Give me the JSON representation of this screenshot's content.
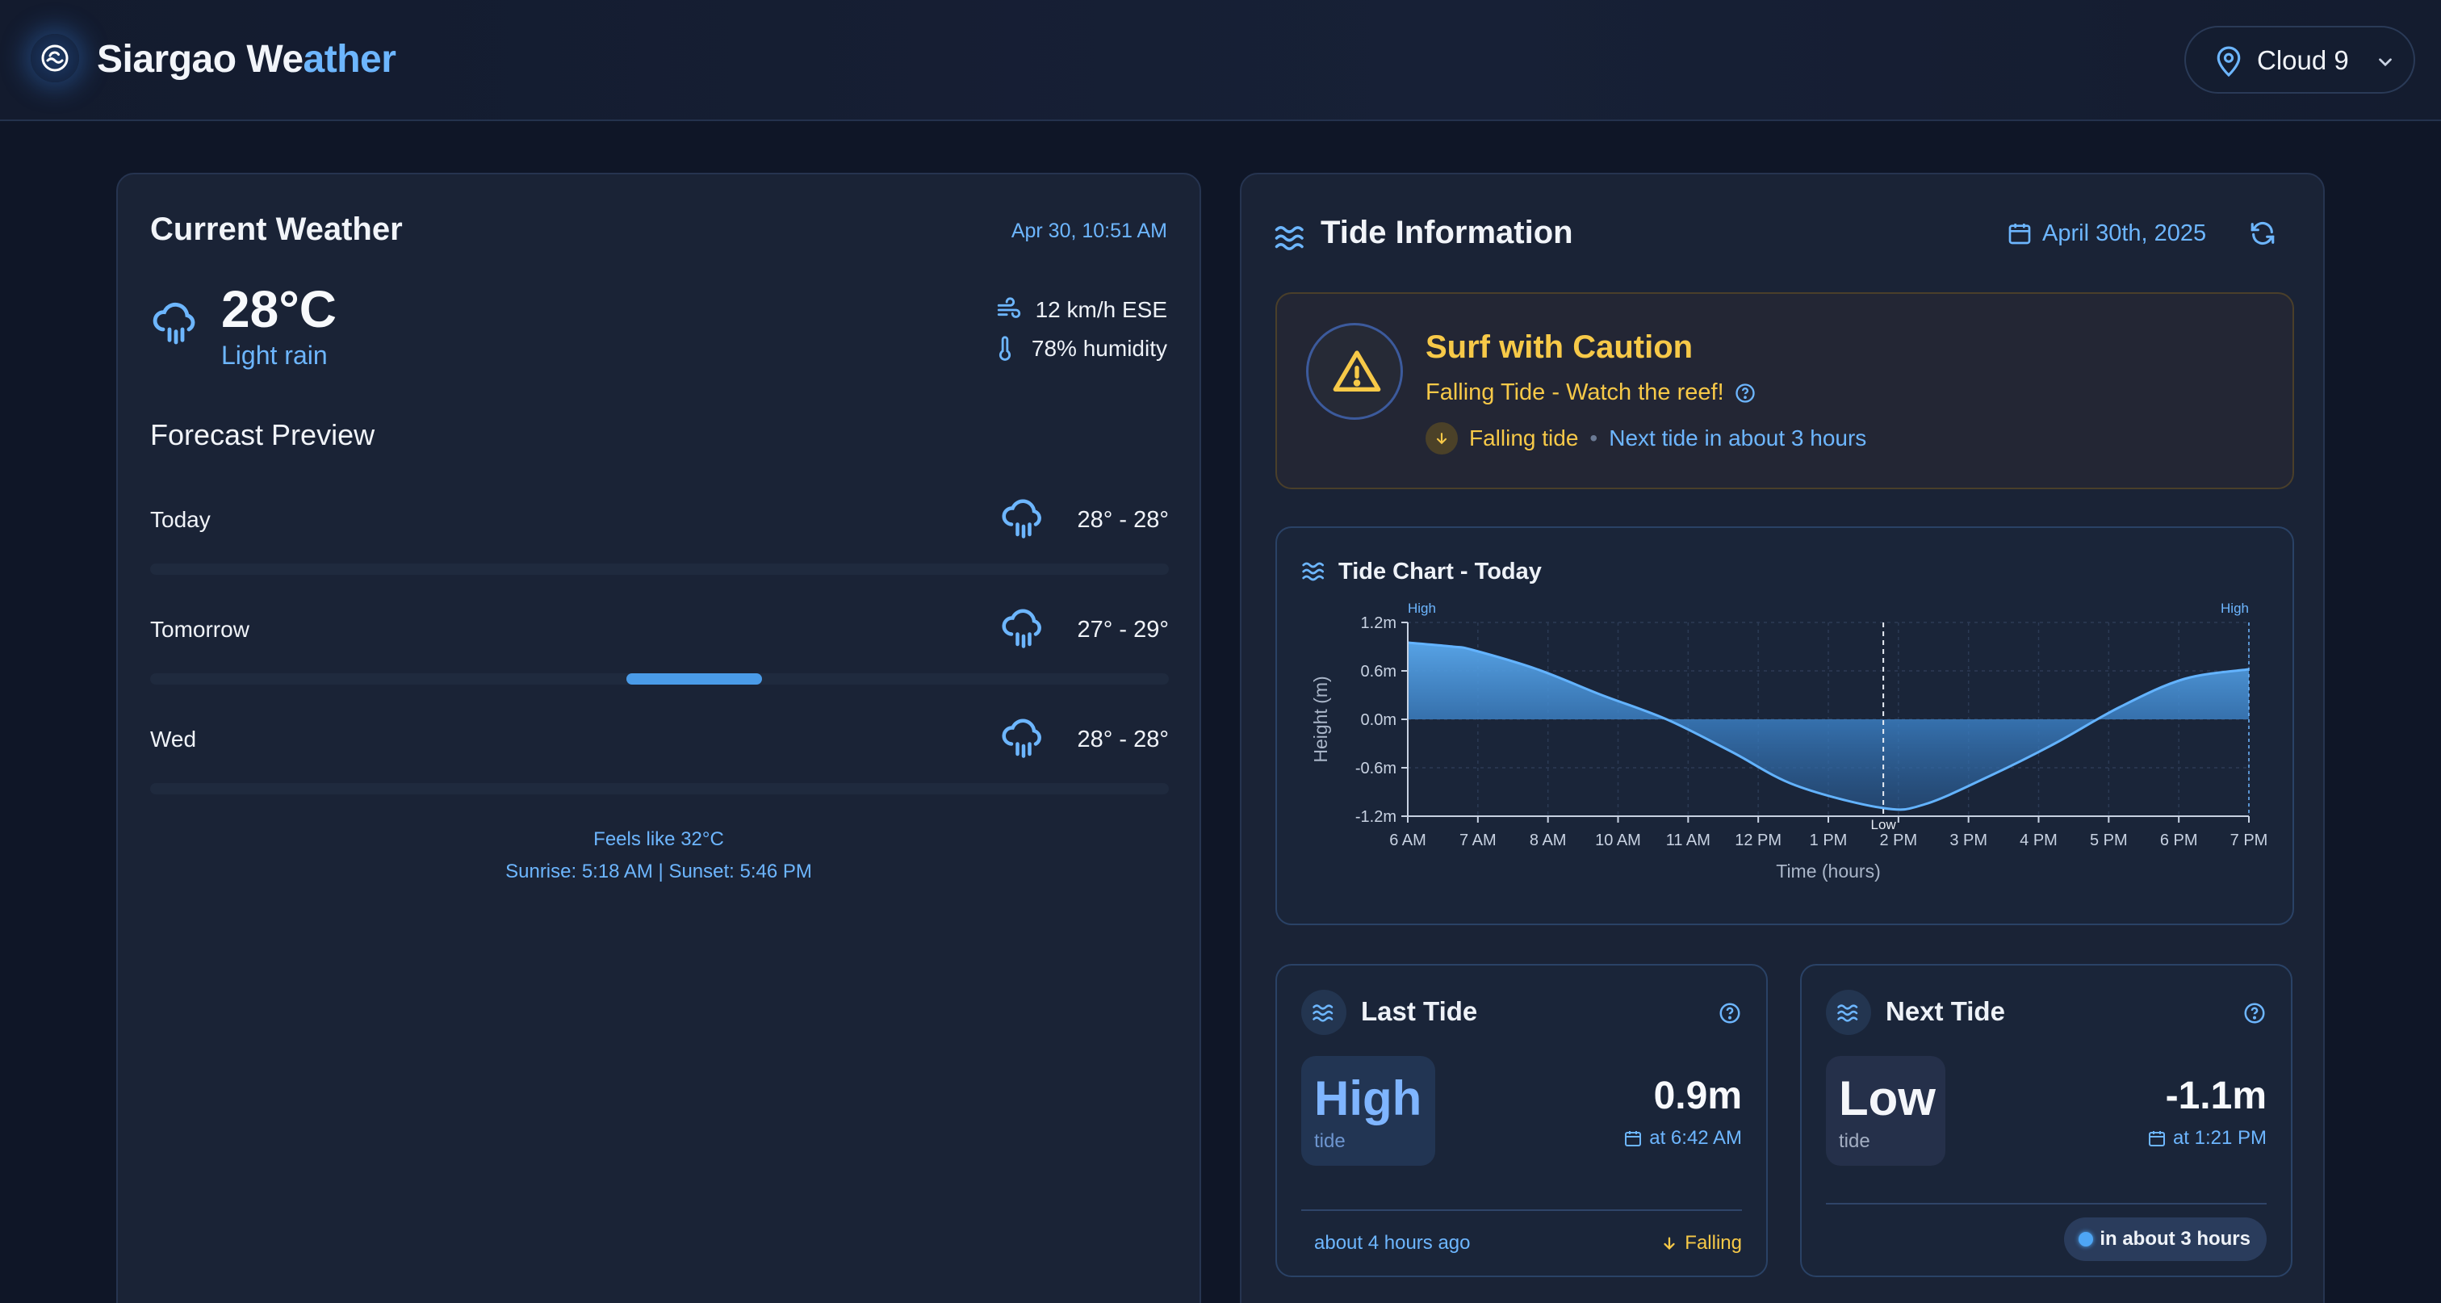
{
  "header": {
    "title_part1": "Siargao We",
    "title_part2": "ather",
    "location": "Cloud 9"
  },
  "current_weather": {
    "title": "Current Weather",
    "timestamp": "Apr 30, 10:51 AM",
    "temperature": "28°C",
    "condition": "Light rain",
    "wind": "12 km/h ESE",
    "humidity": "78% humidity",
    "forecast_title": "Forecast Preview",
    "forecast": [
      {
        "day": "Today",
        "temp": "28° - 28°",
        "icon": "rain-cloud-icon"
      },
      {
        "day": "Tomorrow",
        "temp": "27° - 29°",
        "icon": "rain-cloud-icon"
      },
      {
        "day": "Wed",
        "temp": "28° - 28°",
        "icon": "rain-cloud-icon"
      }
    ],
    "feels_like": "Feels like 32°C",
    "sun": "Sunrise: 5:18 AM | Sunset: 5:46 PM"
  },
  "tide": {
    "title": "Tide Information",
    "date": "April 30th, 2025",
    "caution": {
      "title": "Surf with Caution",
      "subtitle": "Falling Tide - Watch the reef!",
      "trend": "Falling tide",
      "separator": "•",
      "next": "Next tide in about 3 hours"
    },
    "chart_title": "Tide Chart - Today",
    "last": {
      "title": "Last Tide",
      "type": "High",
      "type_sub": "tide",
      "height": "0.9m",
      "time": "at 6:42 AM",
      "ago": "about 4 hours ago",
      "trend": "Falling"
    },
    "next_tide": {
      "title": "Next Tide",
      "type": "Low",
      "type_sub": "tide",
      "height": "-1.1m",
      "time": "at 1:21 PM",
      "eta": "in about 3 hours"
    }
  },
  "colors": {
    "accent": "#6db6ff",
    "caution": "#f7c948",
    "background": "#0f1627",
    "card": "#1a2336"
  },
  "chart_data": {
    "type": "area",
    "title": "Tide Chart - Today",
    "xlabel": "Time (hours)",
    "ylabel": "Height (m)",
    "x_ticks": [
      "6 AM",
      "7 AM",
      "8 AM",
      "10 AM",
      "11 AM",
      "12 PM",
      "1 PM",
      "2 PM",
      "3 PM",
      "4 PM",
      "5 PM",
      "6 PM",
      "7 PM"
    ],
    "y_ticks": [
      "1.2m",
      "0.6m",
      "0.0m",
      "-0.6m",
      "-1.2m"
    ],
    "ylim": [
      -1.2,
      1.2
    ],
    "x": [
      6,
      6.7,
      7,
      8,
      9,
      10,
      11,
      12,
      13.35,
      14,
      15,
      16,
      17,
      18,
      19
    ],
    "y": [
      0.95,
      0.9,
      0.86,
      0.62,
      0.3,
      0.0,
      -0.4,
      -0.82,
      -1.1,
      -1.05,
      -0.7,
      -0.3,
      0.15,
      0.5,
      0.62
    ],
    "annotations": [
      {
        "label": "High",
        "x": 6
      },
      {
        "label": "Low",
        "x": 13.35
      },
      {
        "label": "High",
        "x": 19
      }
    ],
    "grid": true
  }
}
